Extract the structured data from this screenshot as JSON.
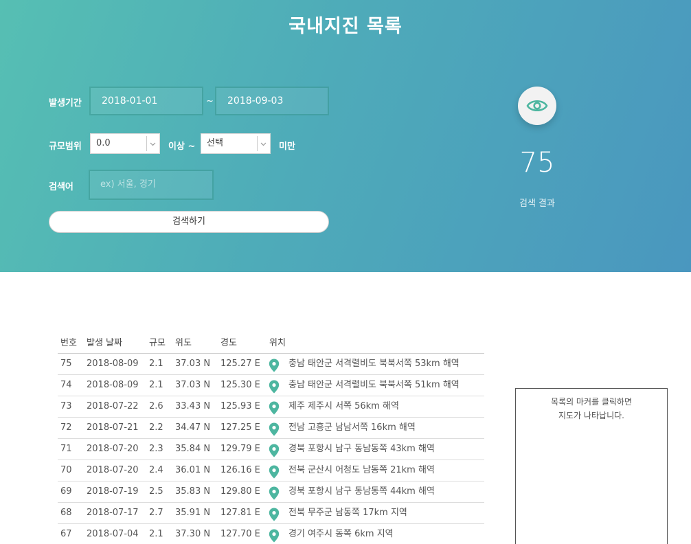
{
  "header": {
    "title": "국내지진 목록"
  },
  "filters": {
    "period_label": "발생기간",
    "start_date": "2018-01-01",
    "separator": "~",
    "end_date": "2018-09-03",
    "magnitude_label": "규모범위",
    "magnitude_min": "0.0",
    "above_label": "이상 ~",
    "magnitude_max": "선택",
    "below_label": "미만",
    "keyword_label": "검색어",
    "keyword_placeholder": "ex) 서울, 경기",
    "search_button": "검색하기"
  },
  "result": {
    "icon": "eye-icon",
    "count": "75",
    "label": "검색 결과"
  },
  "table": {
    "columns": [
      "번호",
      "발생 날짜",
      "규모",
      "위도",
      "경도",
      "위치"
    ],
    "rows": [
      {
        "no": "75",
        "date": "2018-08-09",
        "mag": "2.1",
        "lat": "37.03 N",
        "lon": "125.27 E",
        "loc": "충남 태안군 서격렬비도 북북서쪽 53km 해역"
      },
      {
        "no": "74",
        "date": "2018-08-09",
        "mag": "2.1",
        "lat": "37.03 N",
        "lon": "125.30 E",
        "loc": "충남 태안군 서격렬비도 북북서쪽 51km 해역"
      },
      {
        "no": "73",
        "date": "2018-07-22",
        "mag": "2.6",
        "lat": "33.43 N",
        "lon": "125.93 E",
        "loc": "제주 제주시 서쪽 56km 해역"
      },
      {
        "no": "72",
        "date": "2018-07-21",
        "mag": "2.2",
        "lat": "34.47 N",
        "lon": "127.25 E",
        "loc": "전남 고흥군 남남서쪽 16km 해역"
      },
      {
        "no": "71",
        "date": "2018-07-20",
        "mag": "2.3",
        "lat": "35.84 N",
        "lon": "129.79 E",
        "loc": "경북 포항시 남구 동남동쪽 43km 해역"
      },
      {
        "no": "70",
        "date": "2018-07-20",
        "mag": "2.4",
        "lat": "36.01 N",
        "lon": "126.16 E",
        "loc": "전북 군산시 어청도 남동쪽 21km 해역"
      },
      {
        "no": "69",
        "date": "2018-07-19",
        "mag": "2.5",
        "lat": "35.83 N",
        "lon": "129.80 E",
        "loc": "경북 포항시 남구 동남동쪽 44km 해역"
      },
      {
        "no": "68",
        "date": "2018-07-17",
        "mag": "2.7",
        "lat": "35.91 N",
        "lon": "127.81 E",
        "loc": "전북 무주군 남동쪽 17km 지역"
      },
      {
        "no": "67",
        "date": "2018-07-04",
        "mag": "2.1",
        "lat": "37.30 N",
        "lon": "127.70 E",
        "loc": "경기 여주시 동쪽 6km 지역"
      }
    ],
    "marker_icon": "map-marker-icon",
    "marker_color": "#4db6a0"
  },
  "map": {
    "line1": "목록의 마커를 클릭하면",
    "line2": "지도가 나타납니다."
  }
}
